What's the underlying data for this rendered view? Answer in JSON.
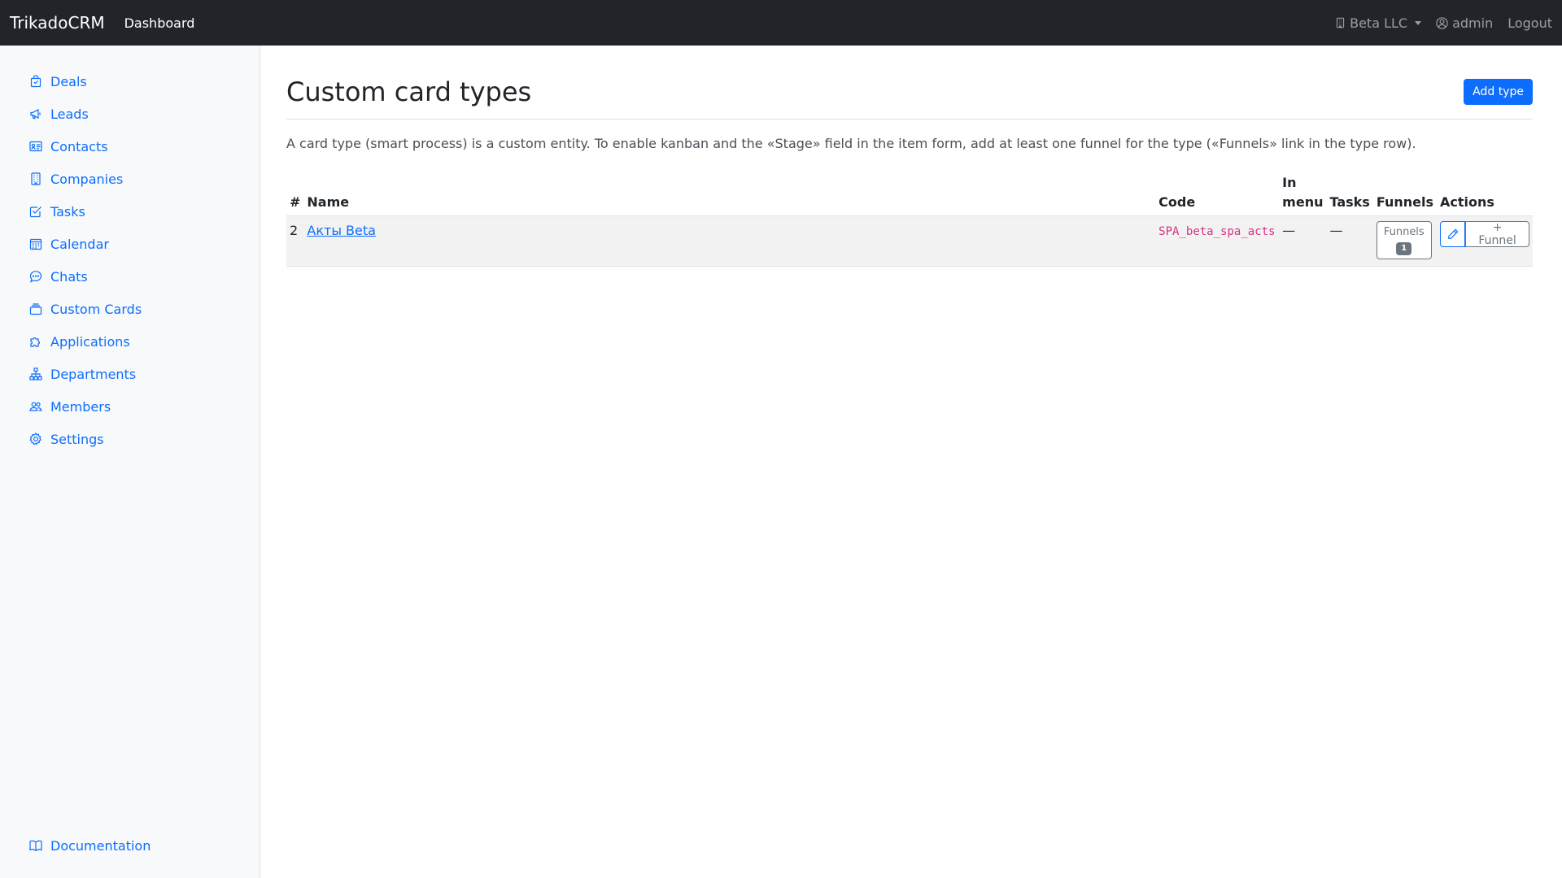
{
  "navbar": {
    "brand": "TrikadoCRM",
    "dashboard": "Dashboard",
    "company": "Beta LLC",
    "user": "admin",
    "logout": "Logout"
  },
  "sidebar": {
    "items": [
      {
        "label": "Deals",
        "icon": "bag-icon"
      },
      {
        "label": "Leads",
        "icon": "megaphone-icon"
      },
      {
        "label": "Contacts",
        "icon": "contact-card-icon"
      },
      {
        "label": "Companies",
        "icon": "building-icon"
      },
      {
        "label": "Tasks",
        "icon": "check-square-icon"
      },
      {
        "label": "Calendar",
        "icon": "calendar-icon"
      },
      {
        "label": "Chats",
        "icon": "chat-icon"
      },
      {
        "label": "Custom Cards",
        "icon": "cards-icon"
      },
      {
        "label": "Applications",
        "icon": "puzzle-icon"
      },
      {
        "label": "Departments",
        "icon": "diagram-icon"
      },
      {
        "label": "Members",
        "icon": "people-icon"
      },
      {
        "label": "Settings",
        "icon": "gear-icon"
      }
    ],
    "documentation": "Documentation"
  },
  "page": {
    "title": "Custom card types",
    "add_button": "Add type",
    "description": "A card type (smart process) is a custom entity. To enable kanban and the «Stage» field in the item form, add at least one funnel for the type («Funnels» link in the type row)."
  },
  "table": {
    "headers": {
      "num": "#",
      "name": "Name",
      "code": "Code",
      "in_menu_1": "In",
      "in_menu_2": "menu",
      "tasks": "Tasks",
      "funnels": "Funnels",
      "actions": "Actions"
    },
    "rows": [
      {
        "num": "2",
        "name": "Акты Beta",
        "code": "SPA_beta_spa_acts",
        "in_menu": "—",
        "tasks": "—",
        "funnels_label": "Funnels",
        "funnels_count": "1",
        "add_funnel": "+ Funnel"
      }
    ]
  },
  "colors": {
    "navbar_bg": "#212529",
    "sidebar_bg": "#f8f9fa",
    "link": "#0d6efd",
    "code": "#d63384"
  }
}
